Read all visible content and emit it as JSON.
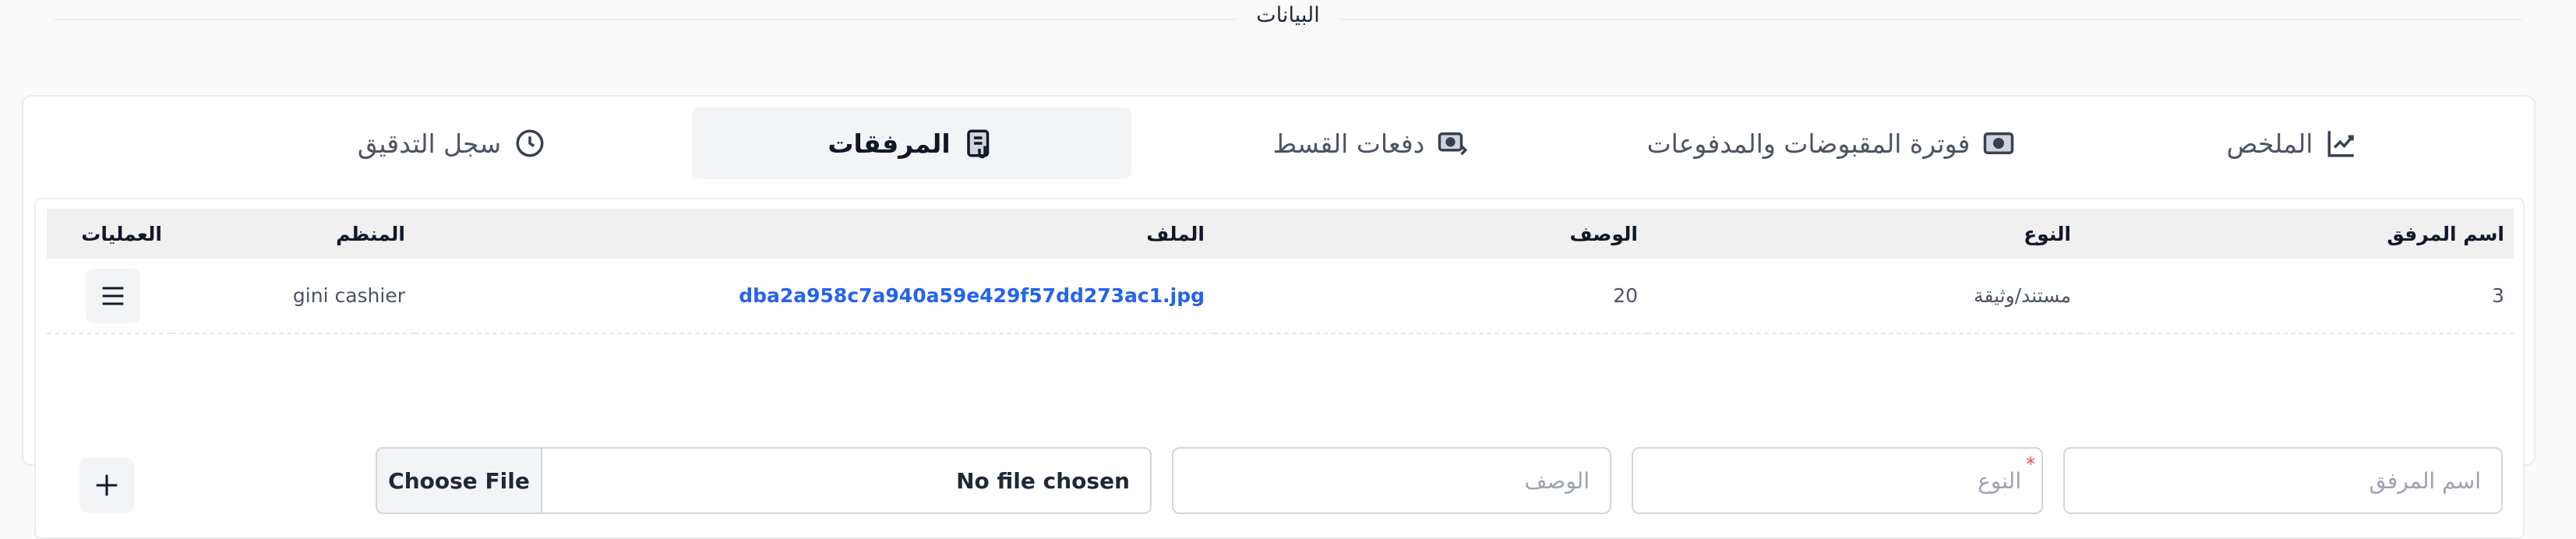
{
  "section": {
    "title": "البيانات"
  },
  "tabs": [
    {
      "label": "الملخص",
      "icon": "summary-chart-icon",
      "active": false
    },
    {
      "label": "فوترة المقبوضات والمدفوعات",
      "icon": "cash-billing-icon",
      "active": false
    },
    {
      "label": "دفعات القسط",
      "icon": "installment-payments-icon",
      "active": false
    },
    {
      "label": "المرفقات",
      "icon": "attachment-document-icon",
      "active": true
    },
    {
      "label": "سجل التدقيق",
      "icon": "history-clock-icon",
      "active": false
    }
  ],
  "table": {
    "headers": {
      "name": "اسم المرفق",
      "type": "النوع",
      "description": "الوصف",
      "file": "الملف",
      "organizer": "المنظم",
      "actions": "العمليات"
    },
    "rows": [
      {
        "name": "3",
        "type": "مستند/وثيقة",
        "description": "20",
        "file": "dba2a958c7a940a59e429f57dd273ac1.jpg",
        "organizer": "gini cashier"
      }
    ]
  },
  "form": {
    "name_placeholder": "اسم المرفق",
    "type_placeholder": "النوع",
    "type_required_mark": "*",
    "description_placeholder": "الوصف",
    "choose_file_label": "Choose File",
    "no_file_label": "No file chosen"
  },
  "colors": {
    "link": "#2563eb",
    "required": "#ef4444",
    "active_tab_bg": "#f3f4f6"
  }
}
